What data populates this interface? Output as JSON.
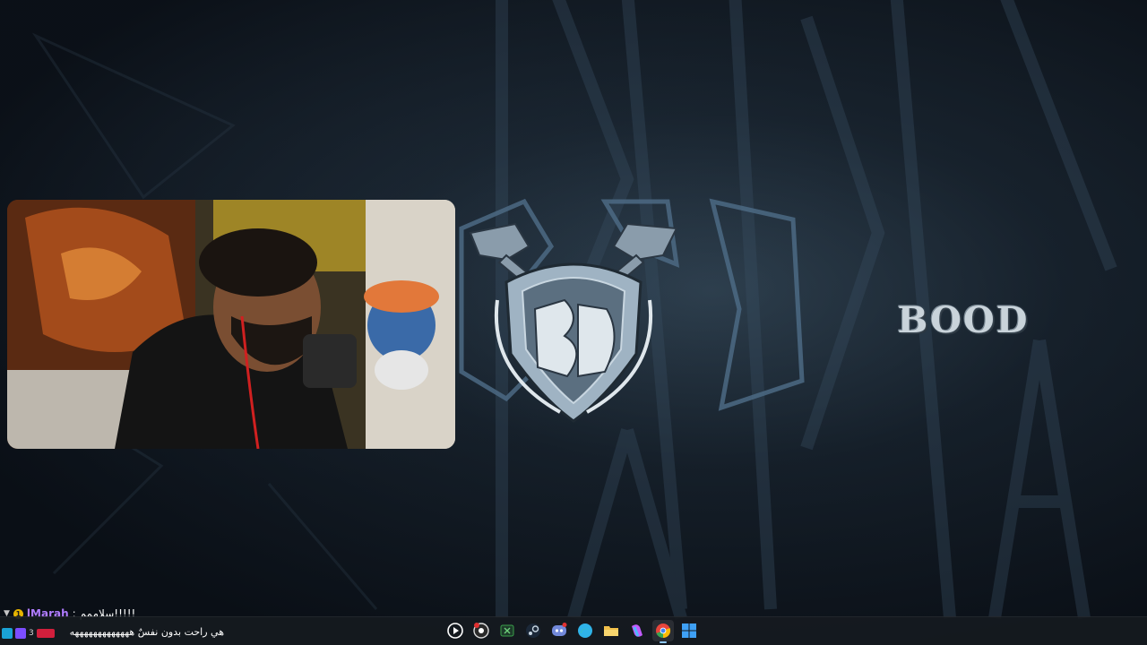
{
  "stream": {
    "brand_text": "BOOD",
    "emblem_icon": "bood-shield-emblem-icon",
    "accent_color": "#9fb3c3"
  },
  "chat": {
    "line1": {
      "badge": "1",
      "username": "lMarah",
      "separator": ":",
      "message": "سلاممم!!!!!"
    },
    "line2": {
      "message": "هي راحت بدون نفسٌ هههههههههههههه"
    }
  },
  "taskbar": {
    "tray_label": "3",
    "icons": [
      {
        "name": "media-player-icon",
        "color": "#ffffff"
      },
      {
        "name": "obs-record-icon",
        "color": "#e03030"
      },
      {
        "name": "xbox-icon",
        "color": "#3aa04a"
      },
      {
        "name": "steam-icon",
        "color": "#c7d5e0"
      },
      {
        "name": "discord-icon",
        "color": "#7289da"
      },
      {
        "name": "edge-icon",
        "color": "#2fb3e8"
      },
      {
        "name": "file-explorer-icon",
        "color": "#f2c04a"
      },
      {
        "name": "copilot-icon",
        "color": "#c35cff"
      },
      {
        "name": "chrome-icon",
        "color": "#e8453c"
      },
      {
        "name": "start-menu-icon",
        "color": "#3ea0f5"
      }
    ]
  }
}
